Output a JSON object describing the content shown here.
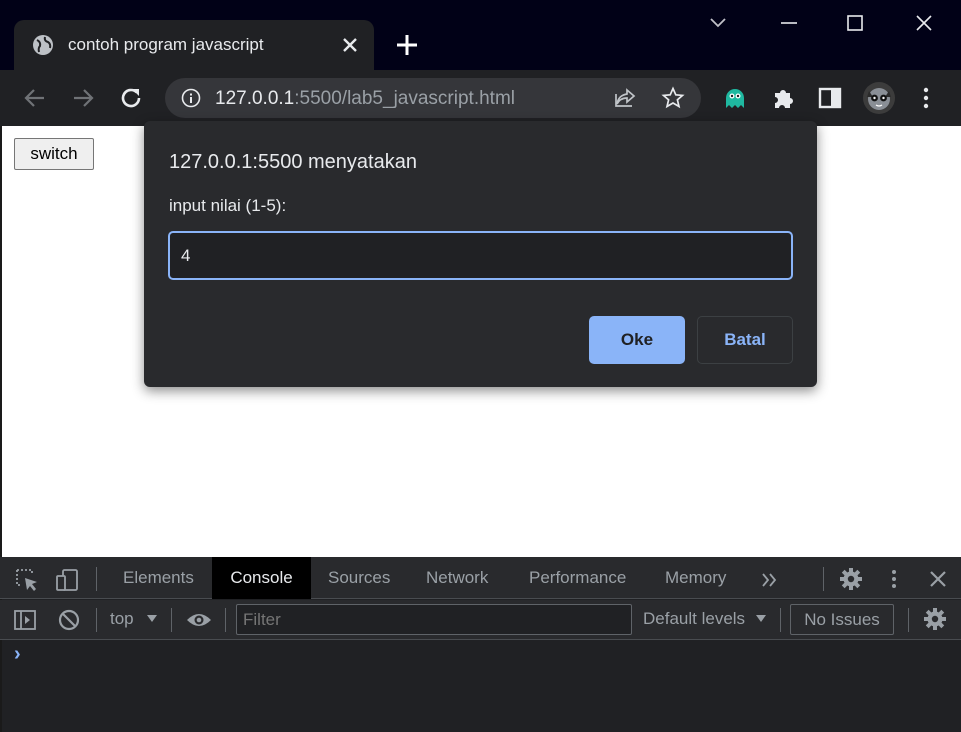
{
  "browser": {
    "tab": {
      "title": "contoh program javascript"
    },
    "address": {
      "host": "127.0.0.1",
      "rest": ":5500/lab5_javascript.html"
    }
  },
  "page": {
    "switch_label": "switch"
  },
  "dialog": {
    "title": "127.0.0.1:5500 menyatakan",
    "prompt": "input nilai (1-5):",
    "value": "4",
    "ok_label": "Oke",
    "cancel_label": "Batal"
  },
  "devtools": {
    "tabs": [
      {
        "label": "Elements"
      },
      {
        "label": "Console"
      },
      {
        "label": "Sources"
      },
      {
        "label": "Network"
      },
      {
        "label": "Performance"
      },
      {
        "label": "Memory"
      }
    ],
    "active_tab": "Console",
    "console": {
      "context": "top",
      "filter_placeholder": "Filter",
      "levels": "Default levels",
      "issues": "No Issues",
      "prompt": "›"
    }
  },
  "colors": {
    "accent": "#8ab4f8",
    "titlebar": "#010117",
    "toolbar": "#202124",
    "dialog": "#292a2d"
  }
}
